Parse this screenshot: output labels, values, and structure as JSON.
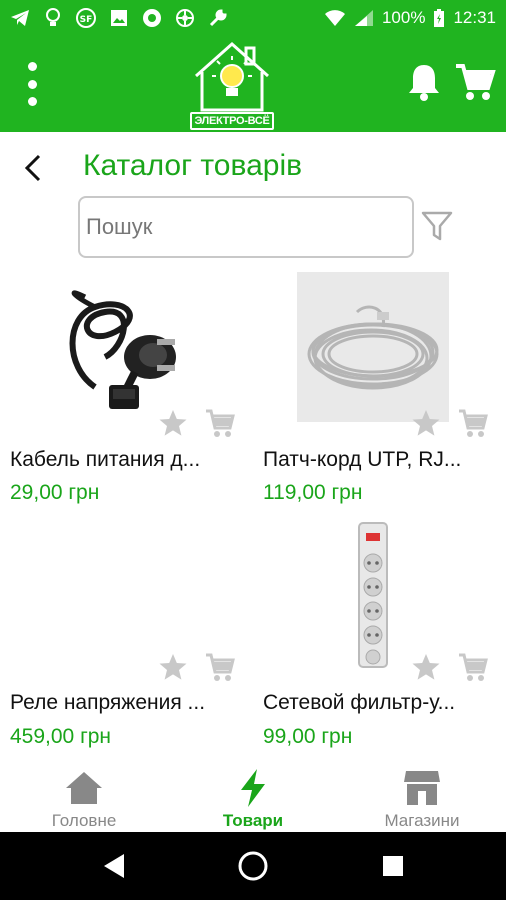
{
  "status_bar": {
    "battery": "100%",
    "time": "12:31",
    "icons": [
      "telegram-icon",
      "lightbulb-icon",
      "sf-icon",
      "image-icon",
      "circle-icon",
      "aperture-icon",
      "wrench-icon",
      "wifi-icon",
      "signal-icon",
      "battery-icon"
    ]
  },
  "app_bar": {
    "logo_text": "ЭЛЕКТРО-ВСЁ",
    "icons": [
      "menu-dots-icon",
      "bell-icon",
      "cart-icon"
    ]
  },
  "header": {
    "title": "Каталог товарів"
  },
  "search": {
    "placeholder": "Пошук"
  },
  "products": [
    {
      "name": "Кабель питания д...",
      "price": "29,00 грн",
      "image": "power-cable"
    },
    {
      "name": "Патч-корд UTP, RJ...",
      "price": "119,00 грн",
      "image": "patch-cord"
    },
    {
      "name": "Реле напряжения ...",
      "price": "459,00 грн",
      "image": "none"
    },
    {
      "name": "Сетевой фильтр-у...",
      "price": "99,00 грн",
      "image": "power-strip"
    }
  ],
  "bottom_nav": {
    "items": [
      {
        "label": "Головне",
        "icon": "home-icon",
        "active": false
      },
      {
        "label": "Товари",
        "icon": "lightning-icon",
        "active": true
      },
      {
        "label": "Магазини",
        "icon": "store-icon",
        "active": false
      }
    ]
  },
  "colors": {
    "primary": "#20b420",
    "accent_text": "#1aa51a",
    "inactive": "#888888"
  }
}
